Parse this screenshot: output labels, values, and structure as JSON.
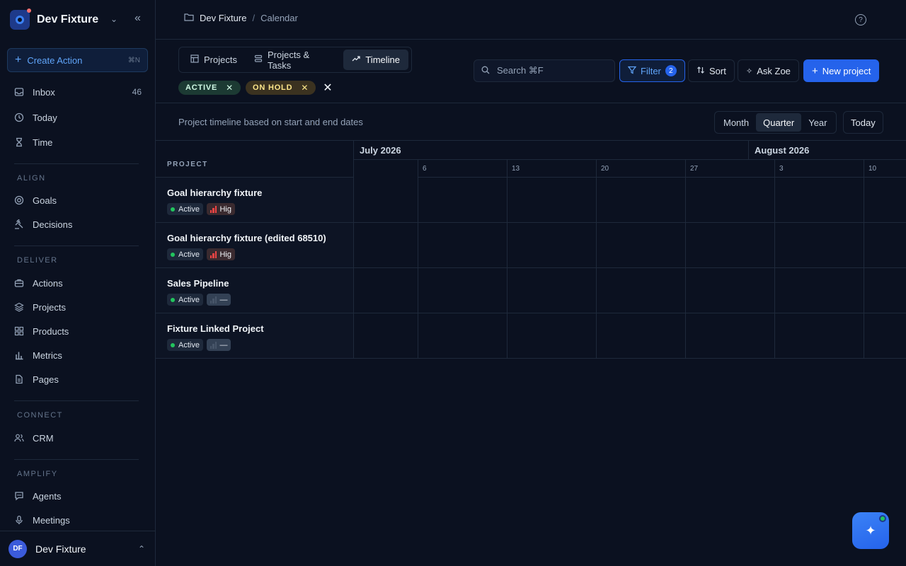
{
  "workspace": {
    "name": "Dev Fixture"
  },
  "sidebar": {
    "create_label": "Create Action",
    "create_shortcut": "⌘N",
    "top_items": [
      {
        "label": "Inbox",
        "count": "46",
        "icon": "inbox-icon"
      },
      {
        "label": "Today",
        "icon": "clock-icon"
      },
      {
        "label": "Time",
        "icon": "hourglass-icon"
      }
    ],
    "sections": [
      {
        "label": "ALIGN",
        "items": [
          {
            "label": "Goals",
            "icon": "target-icon"
          },
          {
            "label": "Decisions",
            "icon": "gavel-icon"
          }
        ]
      },
      {
        "label": "DELIVER",
        "items": [
          {
            "label": "Actions",
            "icon": "briefcase-icon"
          },
          {
            "label": "Projects",
            "icon": "layers-icon"
          },
          {
            "label": "Products",
            "icon": "grid-icon"
          },
          {
            "label": "Metrics",
            "icon": "bar-chart-icon"
          },
          {
            "label": "Pages",
            "icon": "document-icon"
          }
        ]
      },
      {
        "label": "CONNECT",
        "items": [
          {
            "label": "CRM",
            "icon": "users-icon"
          }
        ]
      },
      {
        "label": "AMPLIFY",
        "items": [
          {
            "label": "Agents",
            "icon": "chat-icon"
          },
          {
            "label": "Meetings",
            "icon": "microphone-icon"
          }
        ]
      }
    ]
  },
  "user": {
    "initials": "DF",
    "name": "Dev Fixture"
  },
  "breadcrumb": {
    "root": "Dev Fixture",
    "separator": "/",
    "current": "Calendar"
  },
  "view_tabs": [
    {
      "label": "Projects",
      "active": false
    },
    {
      "label": "Projects & Tasks",
      "active": false
    },
    {
      "label": "Timeline",
      "active": true
    }
  ],
  "filters": [
    {
      "label": "ACTIVE"
    },
    {
      "label": "ON HOLD"
    }
  ],
  "toolbar": {
    "search_placeholder": "Search ⌘F",
    "filter_label": "Filter",
    "filter_count": "2",
    "sort_label": "Sort",
    "ask_label": "Ask Zoe",
    "new_label": "New project"
  },
  "timeline": {
    "subtitle": "Project timeline based on start and end dates",
    "ranges": [
      "Month",
      "Quarter",
      "Year"
    ],
    "active_range": "Quarter",
    "today_label": "Today",
    "project_header": "PROJECT",
    "months": [
      "July 2026",
      "August 2026"
    ],
    "weeks": [
      "6",
      "13",
      "20",
      "27",
      "3",
      "10"
    ]
  },
  "projects": [
    {
      "name": "Goal hierarchy fixture",
      "status": "Active",
      "priority": "Hig",
      "has_priority": true
    },
    {
      "name": "Goal hierarchy fixture (edited 68510)",
      "status": "Active",
      "priority": "Hig",
      "has_priority": true
    },
    {
      "name": "Sales Pipeline",
      "status": "Active",
      "priority": "—",
      "has_priority": false
    },
    {
      "name": "Fixture Linked Project",
      "status": "Active",
      "priority": "—",
      "has_priority": false
    }
  ],
  "colors": {
    "background": "#0b1120",
    "accent": "#2563eb",
    "active_dot": "#22c55e",
    "priority_high": "#ef4444"
  }
}
